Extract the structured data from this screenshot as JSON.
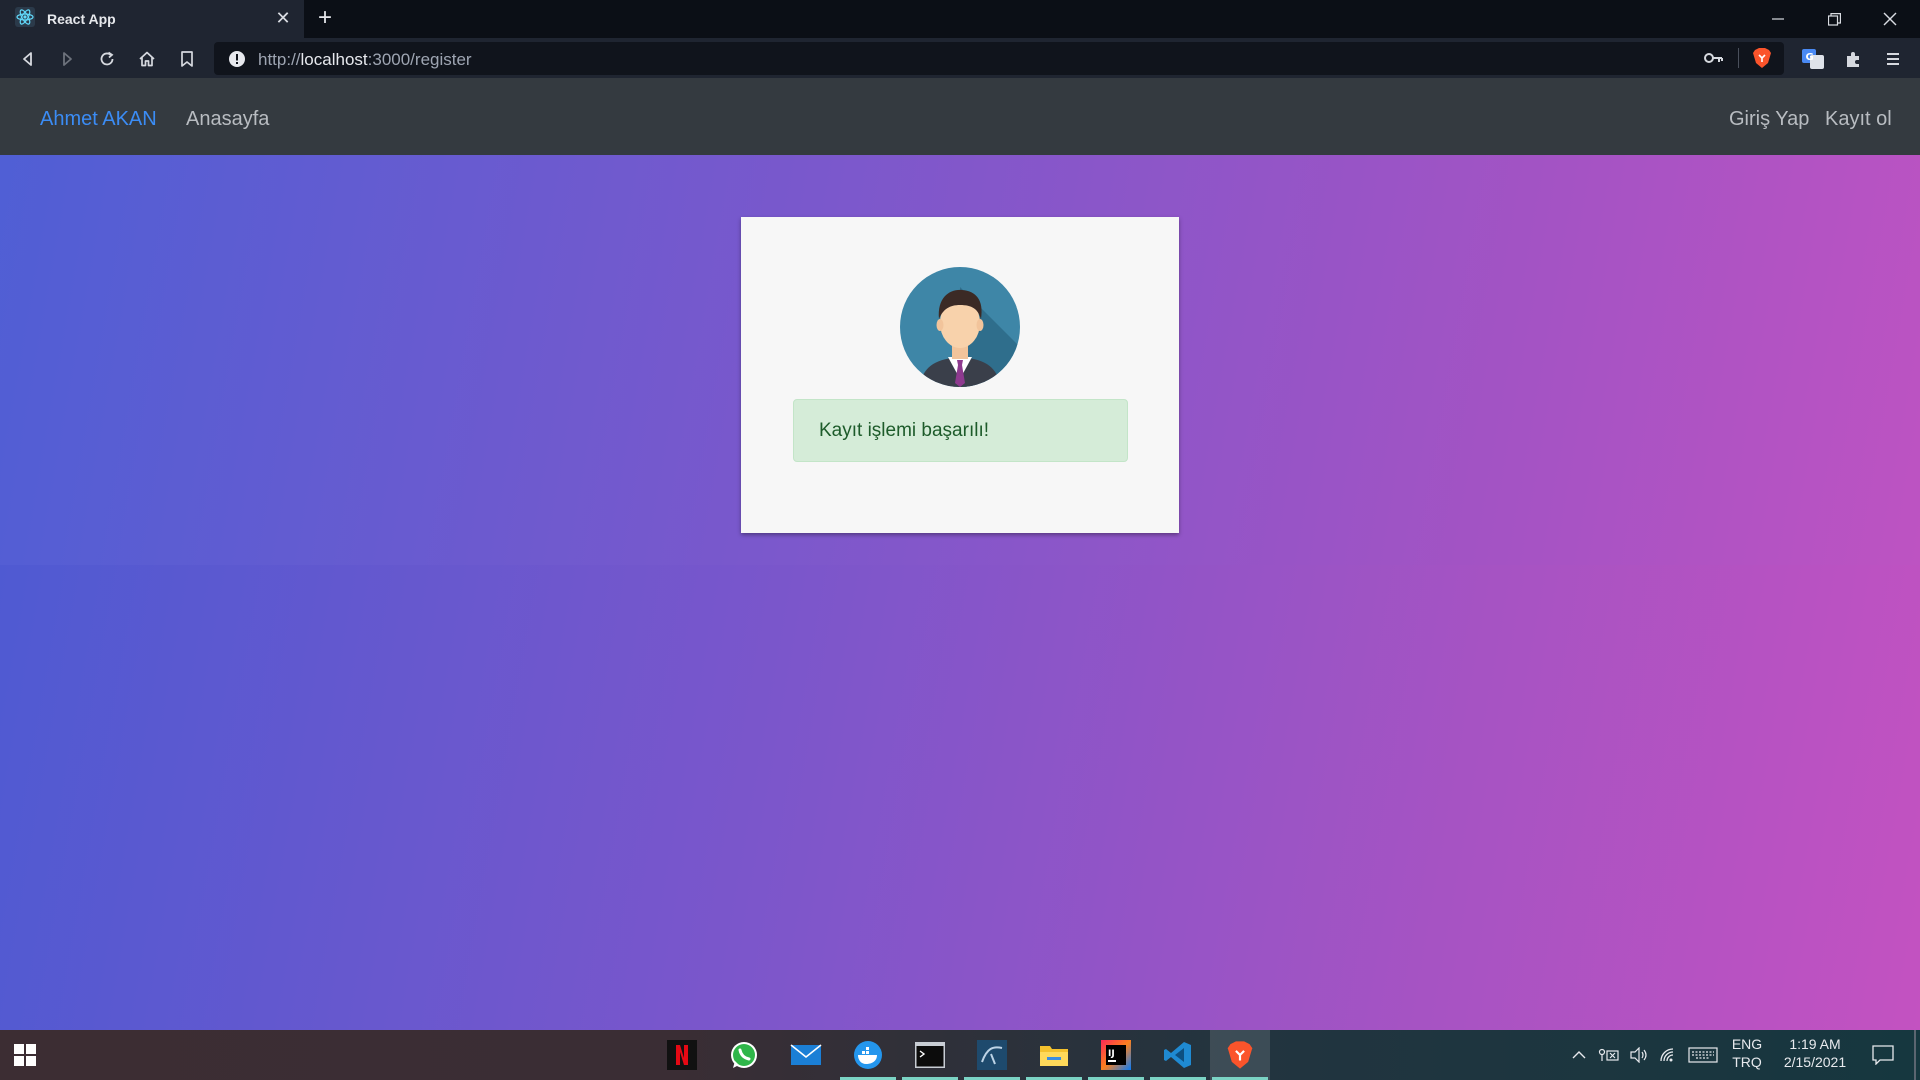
{
  "browser": {
    "tab_title": "React App",
    "url_prefix": "http://",
    "url_host": "localhost",
    "url_path": ":3000/register",
    "icons": [
      "react-icon",
      "close-icon",
      "plus-icon",
      "back-icon",
      "forward-icon",
      "reload-icon",
      "home-icon",
      "bookmark-icon",
      "info-icon",
      "key-icon",
      "brave-shield-icon",
      "translate-icon",
      "extensions-icon",
      "menu-icon"
    ]
  },
  "navbar": {
    "brand": "Ahmet AKAN",
    "home_link": "Anasayfa",
    "login_link": "Giriş Yap",
    "register_link": "Kayıt ol"
  },
  "card": {
    "alert_message": "Kayıt işlemi başarılı!",
    "avatar_icon": "businessman-avatar-icon"
  },
  "taskbar": {
    "apps": [
      "netflix-icon",
      "whatsapp-icon",
      "mail-icon",
      "docker-icon",
      "terminal-icon",
      "mysql-workbench-icon",
      "file-explorer-icon",
      "intellij-icon",
      "vscode-icon",
      "brave-icon"
    ],
    "lang_line1": "ENG",
    "lang_line2": "TRQ",
    "time": "1:19 AM",
    "date": "2/15/2021"
  },
  "colors": {
    "nav_brand": "#3b8cf5",
    "alert_bg": "#d5ecd8",
    "alert_text": "#1d5b2a",
    "navbar_bg": "#343a40"
  }
}
